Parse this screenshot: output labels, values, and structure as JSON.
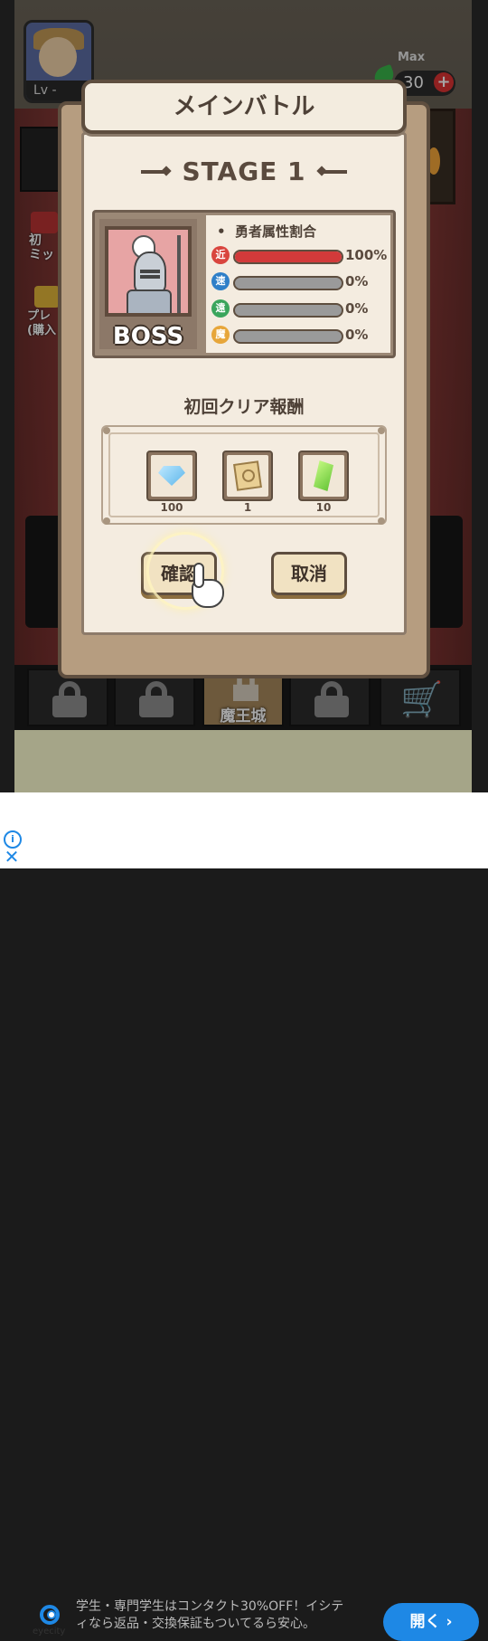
{
  "background": {
    "player_level_label": "Lv  -",
    "stamina_max_label": "Max",
    "stamina_value": "30",
    "side_text_1": "初\nミッ",
    "side_text_2": "プレ\n(購入",
    "castle_label": "魔王城"
  },
  "dialog": {
    "title": "メインバトル",
    "stage": "STAGE  1",
    "boss_label": "BOSS",
    "attributes_heading": "勇者属性割合",
    "attributes": [
      {
        "icon": "近",
        "color": "#d9453e",
        "percent_label": "100%",
        "fill": 1.0
      },
      {
        "icon": "速",
        "color": "#2f7fc8",
        "percent_label": "0%",
        "fill": 0
      },
      {
        "icon": "遠",
        "color": "#3aa55c",
        "percent_label": "0%",
        "fill": 0
      },
      {
        "icon": "魔",
        "color": "#e7a63a",
        "percent_label": "0%",
        "fill": 0
      }
    ],
    "reward_title": "初回クリア報酬",
    "rewards": [
      {
        "icon": "diamond-gem-icon",
        "amount": "100"
      },
      {
        "icon": "treasure-map-icon",
        "amount": "1"
      },
      {
        "icon": "green-crystal-icon",
        "amount": "10"
      }
    ],
    "confirm_label": "確認",
    "cancel_label": "取消"
  },
  "ad": {
    "brand": "eyecity",
    "copy": "学生・専門学生はコンタクト30%OFF！イシティなら返品・交換保証もついてるら安心。",
    "button_label": "開く ›"
  },
  "colors": {
    "accent_red": "#d23a3a",
    "panel_cream": "#f4ece0",
    "ad_blue": "#1e88e5"
  }
}
